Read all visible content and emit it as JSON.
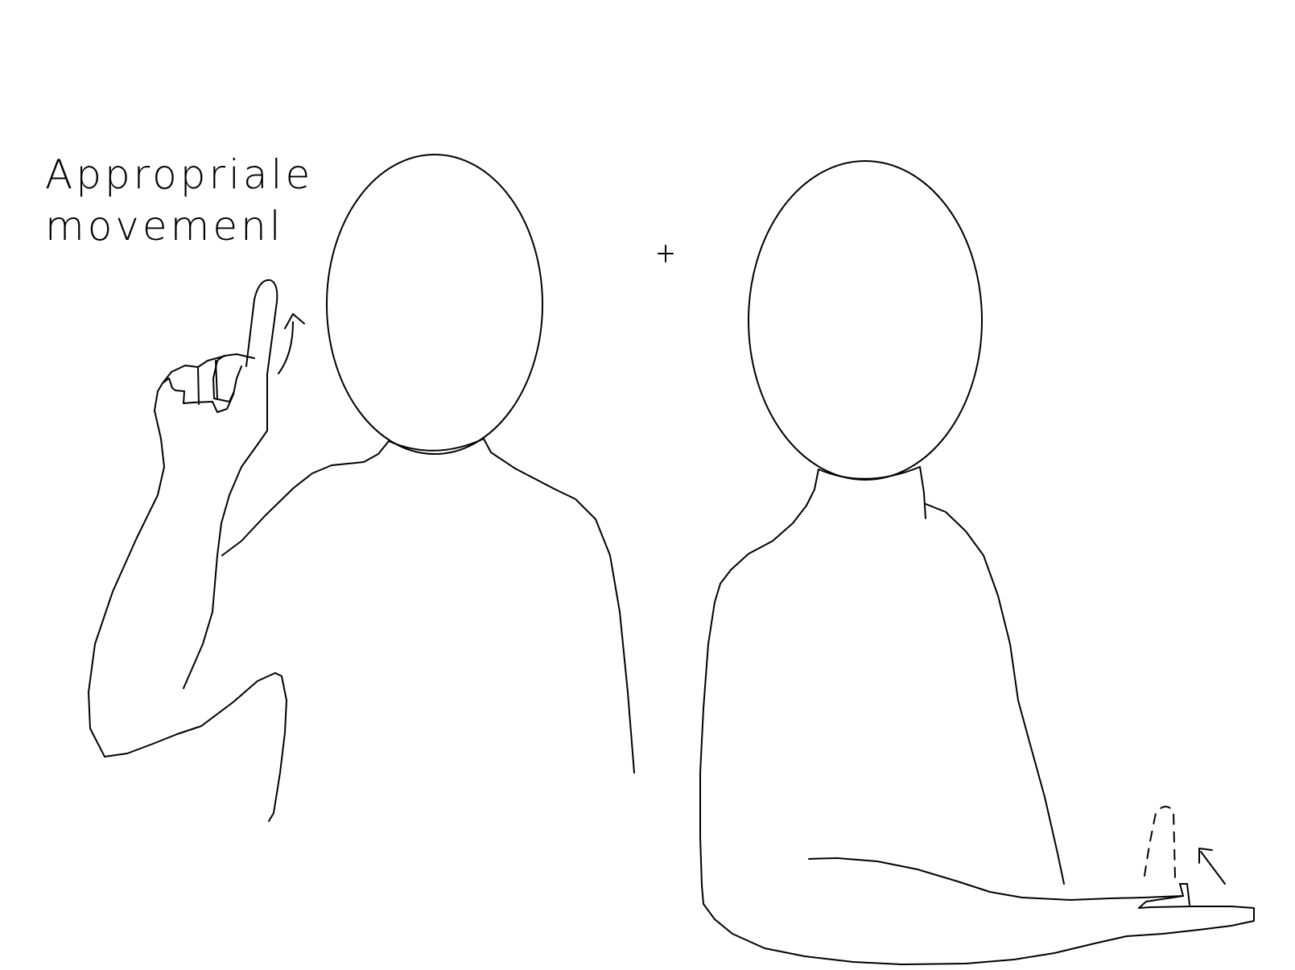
{
  "caption": {
    "line1": "Appropriale",
    "line2": "movemenl"
  },
  "separator": "+",
  "colors": {
    "background": "#ffffff",
    "line": "#000000"
  }
}
